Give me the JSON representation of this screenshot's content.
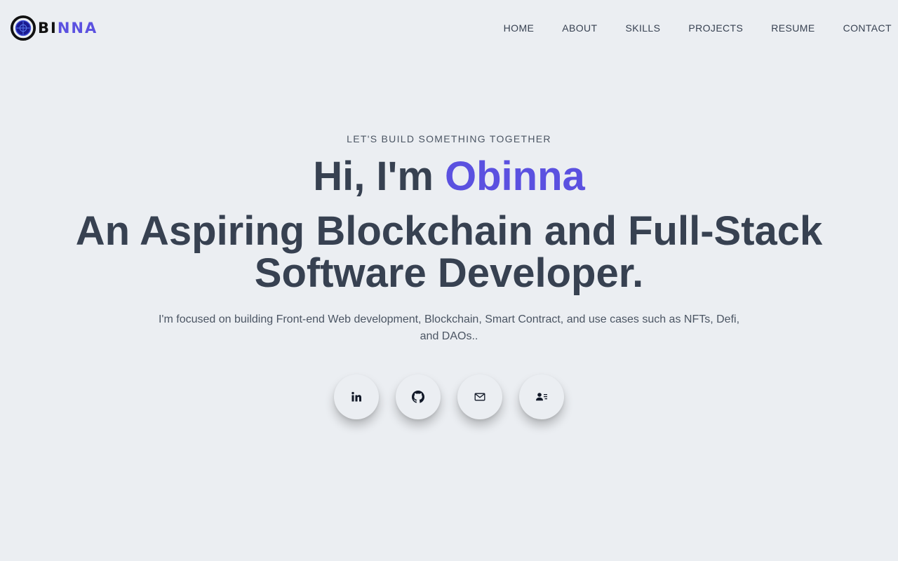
{
  "logo": {
    "text_dark": "BI",
    "text_accent": "NNA",
    "mark_icon": "target-logo-icon"
  },
  "nav": {
    "items": [
      {
        "label": "HOME"
      },
      {
        "label": "ABOUT"
      },
      {
        "label": "SKILLS"
      },
      {
        "label": "PROJECTS"
      },
      {
        "label": "RESUME"
      },
      {
        "label": "CONTACT"
      }
    ]
  },
  "hero": {
    "eyebrow": "LET'S BUILD SOMETHING TOGETHER",
    "greeting_prefix": "Hi, I'm ",
    "greeting_name": "Obinna",
    "headline": "An Aspiring Blockchain and Full-Stack Software Developer.",
    "intro": "I'm focused on building Front-end Web development, Blockchain, Smart Contract, and use cases such as NFTs, Defi, and DAOs.."
  },
  "socials": [
    {
      "icon": "linkedin-icon"
    },
    {
      "icon": "github-icon"
    },
    {
      "icon": "mail-icon"
    },
    {
      "icon": "contact-card-icon"
    }
  ],
  "colors": {
    "background": "#ebeef2",
    "accent": "#5b51e0",
    "text": "#374151"
  }
}
